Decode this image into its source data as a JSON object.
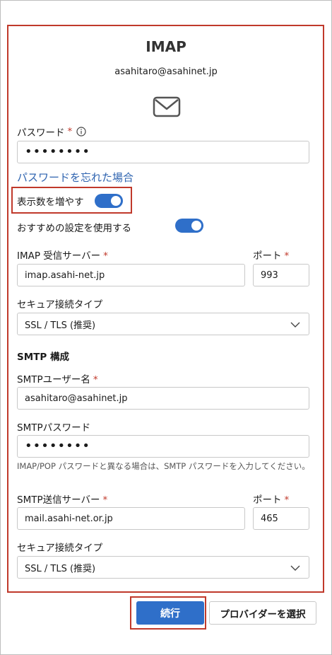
{
  "header": {
    "title": "IMAP",
    "email": "asahitaro@asahinet.jp"
  },
  "password": {
    "label": "パスワード",
    "required_mark": "*",
    "value": "••••••••",
    "forgot_link": "パスワードを忘れた場合"
  },
  "toggles": {
    "show_more": {
      "label": "表示数を増やす",
      "on": true
    },
    "recommended": {
      "label": "おすすめの設定を使用する",
      "on": true
    }
  },
  "imap": {
    "server_label": "IMAP 受信サーバー",
    "server_value": "imap.asahi-net.jp",
    "port_label": "ポート",
    "port_value": "993",
    "security_label": "セキュア接続タイプ",
    "security_value": "SSL / TLS (推奨)"
  },
  "smtp": {
    "section_title": "SMTP 構成",
    "user_label": "SMTPユーザー名",
    "user_value": "asahitaro@asahinet.jp",
    "password_label": "SMTPパスワード",
    "password_value": "••••••••",
    "hint": "IMAP/POP パスワードと異なる場合は、SMTP パスワードを入力してください。",
    "server_label": "SMTP送信サーバー",
    "server_value": "mail.asahi-net.or.jp",
    "port_label": "ポート",
    "port_value": "465",
    "security_label": "セキュア接続タイプ",
    "security_value": "SSL / TLS (推奨)"
  },
  "footer": {
    "continue_label": "続行",
    "provider_label": "プロバイダーを選択"
  },
  "colors": {
    "accent": "#2f6fc9",
    "highlight_border": "#c0392b",
    "link": "#2f64b0"
  }
}
